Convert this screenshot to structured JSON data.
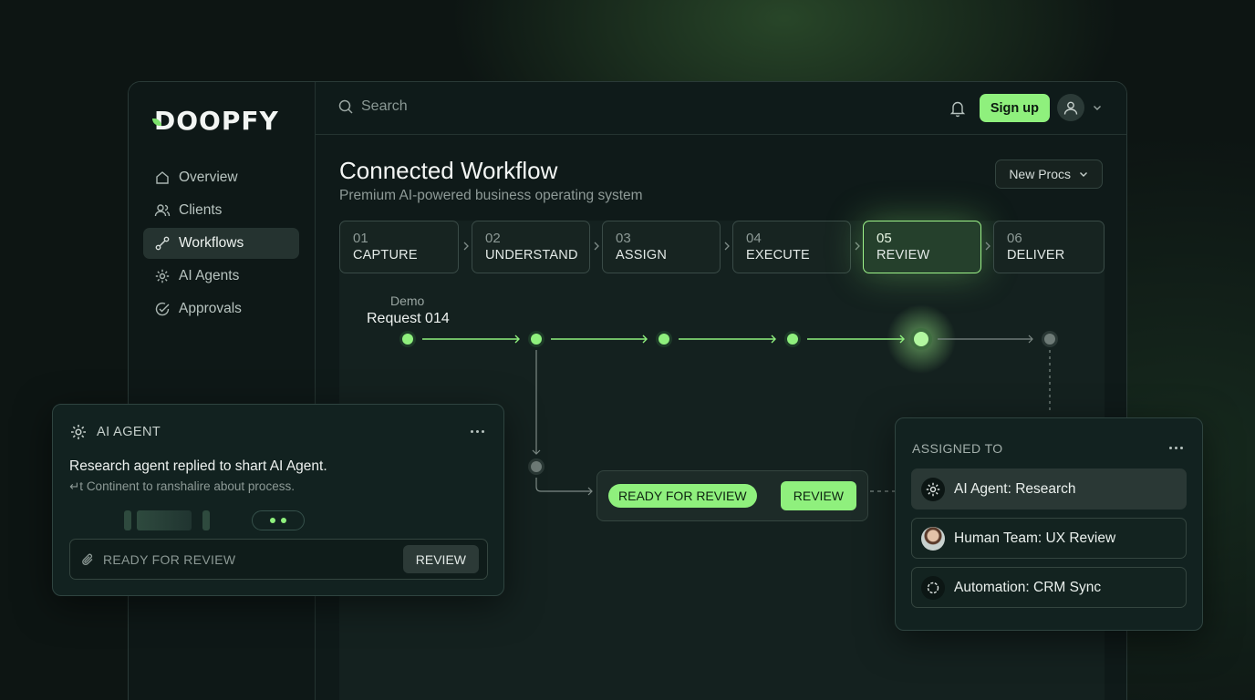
{
  "app": {
    "logo": "DOOPFY"
  },
  "sidebar": {
    "items": [
      {
        "label": "Overview",
        "icon": "home-icon",
        "active": false
      },
      {
        "label": "Clients",
        "icon": "users-icon",
        "active": false
      },
      {
        "label": "Workflows",
        "icon": "workflow-icon",
        "active": true
      },
      {
        "label": "AI Agents",
        "icon": "gear-icon",
        "active": false
      },
      {
        "label": "Approvals",
        "icon": "check-circle-icon",
        "active": false
      }
    ]
  },
  "topbar": {
    "search_placeholder": "Search",
    "signup_label": "Sign up"
  },
  "main": {
    "title": "Connected Workflow",
    "subtitle": "Premium AI-powered business operating system",
    "new_process_label": "New Procs",
    "steps": [
      {
        "num": "01",
        "name": "CAPTURE"
      },
      {
        "num": "02",
        "name": "UNDERSTAND"
      },
      {
        "num": "03",
        "name": "ASSIGN"
      },
      {
        "num": "04",
        "name": "EXECUTE"
      },
      {
        "num": "05",
        "name": "REVIEW",
        "active": true
      },
      {
        "num": "06",
        "name": "DELIVER"
      }
    ],
    "request_label": "Demo",
    "request_title": "Request 014",
    "ready_pill": "READY FOR REVIEW",
    "review_button": "REVIEW"
  },
  "agent_card": {
    "title": "AI AGENT",
    "message": "Research agent replied to shart AI Agent.",
    "sub": "↵t Continent to ranshalire about process.",
    "input_placeholder": "READY FOR REVIEW",
    "review_button": "REVIEW"
  },
  "assign_card": {
    "title": "ASSIGNED TO",
    "items": [
      {
        "label": "AI Agent: Research",
        "icon": "gear-icon"
      },
      {
        "label": "Human Team: UX Review",
        "icon": "avatar"
      },
      {
        "label": "Automation: CRM Sync",
        "icon": "sync-icon"
      }
    ]
  },
  "colors": {
    "accent": "#8ff07d",
    "background": "#0d1513",
    "panel": "#122220"
  }
}
